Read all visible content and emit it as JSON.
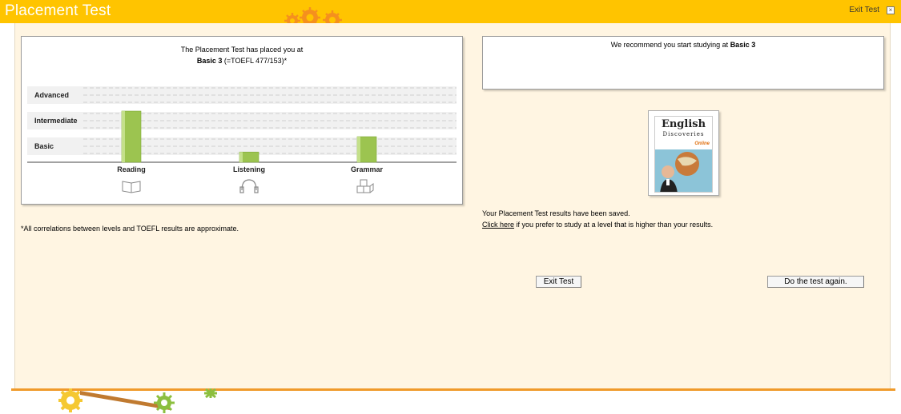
{
  "header": {
    "title": "Placement Test",
    "exit_label": "Exit Test",
    "close_glyph": "⊠"
  },
  "result": {
    "line1": "The Placement Test has placed you at",
    "level": "Basic 3",
    "toefl": " (=TOEFL 477/153)*"
  },
  "chart_data": {
    "type": "bar",
    "categories": [
      "Reading",
      "Listening",
      "Grammar"
    ],
    "level_labels": [
      "Advanced",
      "Intermediate",
      "Basic"
    ],
    "values": [
      2,
      0.4,
      1
    ],
    "ylim": [
      0,
      3
    ],
    "bar_color": "#9cc450",
    "category_icons": [
      "book-icon",
      "headphones-icon",
      "cubes-icon"
    ],
    "grid": true
  },
  "recommendation": {
    "prefix": "We recommend you start studying at ",
    "level": "Basic 3"
  },
  "book": {
    "title_a": "English",
    "title_b": "Discoveries",
    "title_c": "Online"
  },
  "saved_text": "Your Placement Test results have been saved.",
  "click_here": "Click here",
  "higher_text": " if you prefer to study at a level that is higher than your results.",
  "footnote": "*All correlations between levels and TOEFL results are approximate.",
  "buttons": {
    "exit": "Exit Test",
    "again": "Do the test again."
  },
  "colors": {
    "header": "#ffc400",
    "background": "#fff5e2",
    "accent_line": "#f09a2a",
    "gear": "#f5901e",
    "gear_green": "#8cbf3f"
  }
}
